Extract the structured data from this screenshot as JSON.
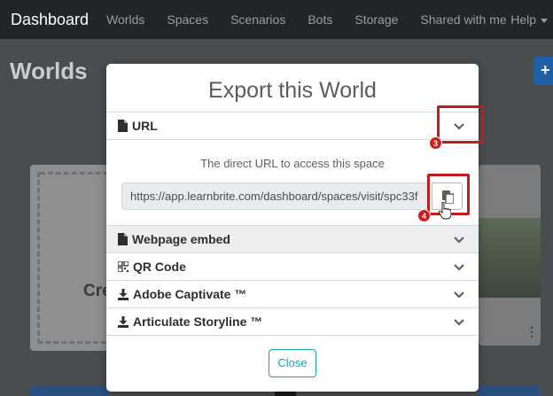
{
  "navbar": {
    "brand": "Dashboard",
    "links": [
      "Worlds",
      "Spaces",
      "Scenarios",
      "Bots",
      "Storage",
      "Shared with me"
    ],
    "help": "Help"
  },
  "page": {
    "title": "Worlds",
    "add_symbol": "+",
    "create_card_text": "Cre"
  },
  "modal": {
    "title": "Export this World",
    "sections": {
      "url": "URL",
      "webpage_embed": "Webpage embed",
      "qr_code": "QR Code",
      "adobe_captivate": "Adobe Captivate ™",
      "articulate_storyline": "Articulate Storyline ™"
    },
    "url_description": "The direct URL to access this space",
    "url_value": "https://app.learnbrite.com/dashboard/spaces/visit/spc33f",
    "close_label": "Close"
  },
  "annotations": {
    "step_3": "3",
    "step_4": "4"
  },
  "colors": {
    "navbar_bg": "#212529",
    "highlight": "#c21d1d",
    "close_btn": "#17a2b8",
    "primary_btn": "#1f5fa6"
  }
}
